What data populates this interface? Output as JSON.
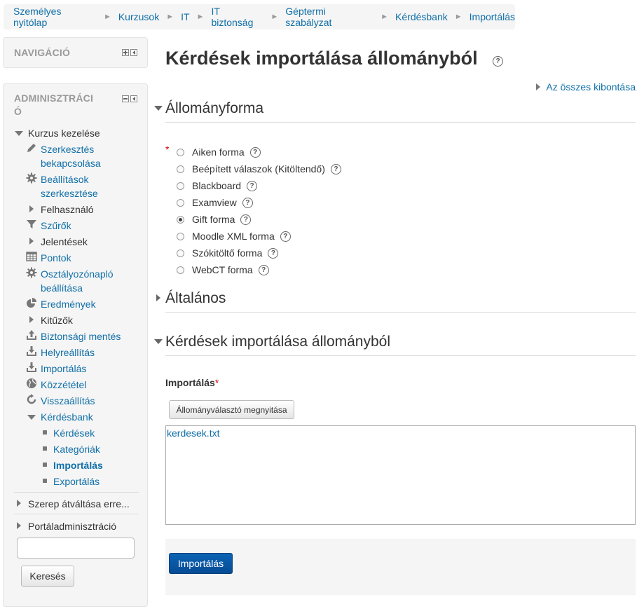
{
  "breadcrumb": [
    "Személyes nyitólap",
    "Kurzusok",
    "IT",
    "IT biztonság",
    "Géptermi szabályzat",
    "Kérdésbank",
    "Importálás"
  ],
  "navigation": {
    "title": "NAVIGÁCIÓ"
  },
  "admin": {
    "title_line1": "ADMINISZTRÁCI",
    "title_line2": "Ó",
    "course_admin": "Kurzus kezelése",
    "items": {
      "edit_line1": "Szerkesztés",
      "edit_line2": "bekapcsolása",
      "settings_line1": "Beállítások",
      "settings_line2": "szerkesztése",
      "users": "Felhasználó",
      "filters": "Szűrők",
      "reports": "Jelentések",
      "grades": "Pontok",
      "gradebook_line1": "Osztályozónapló",
      "gradebook_line2": "beállítása",
      "outcomes": "Eredmények",
      "badges": "Kitűzők",
      "backup": "Biztonsági mentés",
      "restore": "Helyreállítás",
      "import": "Importálás",
      "publish": "Közzététel",
      "reset": "Visszaállítás",
      "question_bank": "Kérdésbank",
      "questions": "Kérdések",
      "categories": "Kategóriák",
      "qb_import": "Importálás",
      "qb_export": "Exportálás"
    },
    "switch_role": "Szerep átváltása erre...",
    "site_admin": "Portáladminisztráció",
    "search_button": "Keresés"
  },
  "main": {
    "title": "Kérdések importálása állományból",
    "expand_all": "Az összes kibontása",
    "section_format": "Állományforma",
    "formats": [
      {
        "label": "Aiken forma",
        "checked": false
      },
      {
        "label": "Beépített válaszok (Kitöltendő)",
        "checked": false
      },
      {
        "label": "Blackboard",
        "checked": false
      },
      {
        "label": "Examview",
        "checked": false
      },
      {
        "label": "Gift forma",
        "checked": true
      },
      {
        "label": "Moodle XML forma",
        "checked": false
      },
      {
        "label": "Szókitöltő forma",
        "checked": false
      },
      {
        "label": "WebCT forma",
        "checked": false
      }
    ],
    "section_general": "Általános",
    "section_import": "Kérdések importálása állományból",
    "import_label": "Importálás",
    "required_mark": "*",
    "filepicker_button": "Állományválasztó megnyitása",
    "file_name": "kerdesek.txt",
    "submit_button": "Importálás"
  }
}
